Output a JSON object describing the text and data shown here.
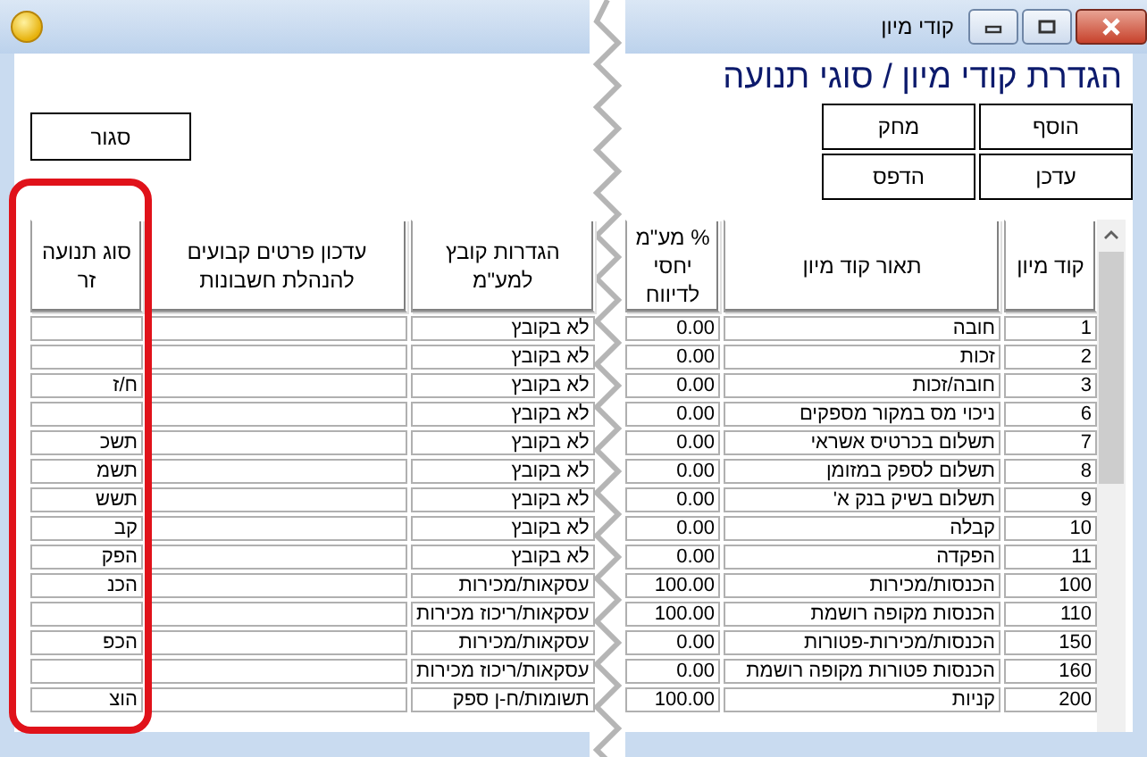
{
  "window": {
    "title": "קודי מיון"
  },
  "heading": "הגדרת קודי מיון / סוגי תנועה",
  "toolbar_buttons": [
    {
      "label": "הוסף"
    },
    {
      "label": "מחק"
    },
    {
      "label": "עדכן"
    },
    {
      "label": "הדפס"
    }
  ],
  "close_button": {
    "label": "סגור"
  },
  "table": {
    "columns": [
      "קוד מיון",
      "תאור קוד מיון",
      "% מע\"מ יחסי לדיווח",
      "הגדרות קובץ למע\"מ",
      "עדכון פרטים קבועים להנהלת חשבונות",
      "סוג תנועה זר"
    ],
    "rows": [
      {
        "code": "1",
        "description": "חובה",
        "vat_percent": "0.00",
        "vat_file": "לא בקובץ"
      },
      {
        "code": "2",
        "description": "זכות",
        "vat_percent": "0.00",
        "vat_file": "לא בקובץ"
      },
      {
        "code": "3",
        "description": "חובה/זכות",
        "vat_percent": "0.00",
        "vat_file": "לא בקובץ",
        "foreign_type": "ח/ז"
      },
      {
        "code": "6",
        "description": "ניכוי מס במקור מספקים",
        "vat_percent": "0.00",
        "vat_file": "לא בקובץ"
      },
      {
        "code": "7",
        "description": "תשלום בכרטיס אשראי",
        "vat_percent": "0.00",
        "vat_file": "לא בקובץ",
        "foreign_type": "תשכ"
      },
      {
        "code": "8",
        "description": "תשלום לספק במזומן",
        "vat_percent": "0.00",
        "vat_file": "לא בקובץ",
        "foreign_type": "תשמ"
      },
      {
        "code": "9",
        "description": "תשלום בשיק בנק א'",
        "vat_percent": "0.00",
        "vat_file": "לא בקובץ",
        "foreign_type": "תשש"
      },
      {
        "code": "10",
        "description": "קבלה",
        "vat_percent": "0.00",
        "vat_file": "לא בקובץ",
        "foreign_type": "קב"
      },
      {
        "code": "11",
        "description": "הפקדה",
        "vat_percent": "0.00",
        "vat_file": "לא בקובץ",
        "foreign_type": "הפק"
      },
      {
        "code": "100",
        "description": "הכנסות/מכירות",
        "vat_percent": "100.00",
        "vat_file": "עסקאות/מכירות",
        "foreign_type": "הכנ"
      },
      {
        "code": "110",
        "description": "הכנסות מקופה רושמת",
        "vat_percent": "100.00",
        "vat_file": "עסקאות/ריכוז מכירות"
      },
      {
        "code": "150",
        "description": "הכנסות/מכירות-פטורות",
        "vat_percent": "0.00",
        "vat_file": "עסקאות/מכירות",
        "foreign_type": "הכפ"
      },
      {
        "code": "160",
        "description": "הכנסות פטורות מקופה רושמת",
        "vat_percent": "0.00",
        "vat_file": "עסקאות/ריכוז מכירות"
      },
      {
        "code": "200",
        "description": "קניות",
        "vat_percent": "100.00",
        "vat_file": "תשומות/ח-ן ספק",
        "foreign_type": "הוצ"
      }
    ]
  }
}
